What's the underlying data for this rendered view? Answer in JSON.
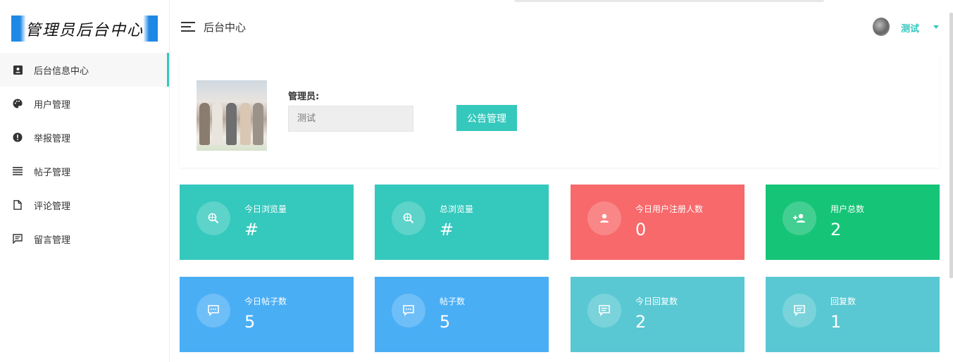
{
  "sidebar": {
    "logo_text": "管理员后台中心",
    "items": [
      {
        "label": "后台信息中心",
        "icon": "id-card-icon",
        "active": true
      },
      {
        "label": "用户管理",
        "icon": "palette-icon"
      },
      {
        "label": "举报管理",
        "icon": "alert-circle-icon"
      },
      {
        "label": "帖子管理",
        "icon": "list-icon"
      },
      {
        "label": "评论管理",
        "icon": "document-icon"
      },
      {
        "label": "留言管理",
        "icon": "message-icon"
      }
    ]
  },
  "header": {
    "title": "后台中心",
    "username": "测试"
  },
  "profile": {
    "admin_label": "管理员:",
    "admin_placeholder": "测试",
    "notice_button": "公告管理"
  },
  "stats": [
    {
      "label": "今日浏览量",
      "value": "#",
      "color": "#35c8bd",
      "icon": "globe-search-icon"
    },
    {
      "label": "总浏览量",
      "value": "#",
      "color": "#35c8bd",
      "icon": "globe-search-icon"
    },
    {
      "label": "今日用户注册人数",
      "value": "0",
      "color": "#f8696b",
      "icon": "person-icon"
    },
    {
      "label": "用户总数",
      "value": "2",
      "color": "#16c477",
      "icon": "add-person-icon"
    },
    {
      "label": "今日帖子数",
      "value": "5",
      "color": "#4aaef5",
      "icon": "chat-bubble-icon"
    },
    {
      "label": "帖子数",
      "value": "5",
      "color": "#4aaef5",
      "icon": "chat-bubble-icon"
    },
    {
      "label": "今日回复数",
      "value": "2",
      "color": "#59c8d3",
      "icon": "comment-icon"
    },
    {
      "label": "回复数",
      "value": "1",
      "color": "#59c8d3",
      "icon": "comment-icon"
    }
  ],
  "colors": {
    "accent": "#35c8bd"
  }
}
